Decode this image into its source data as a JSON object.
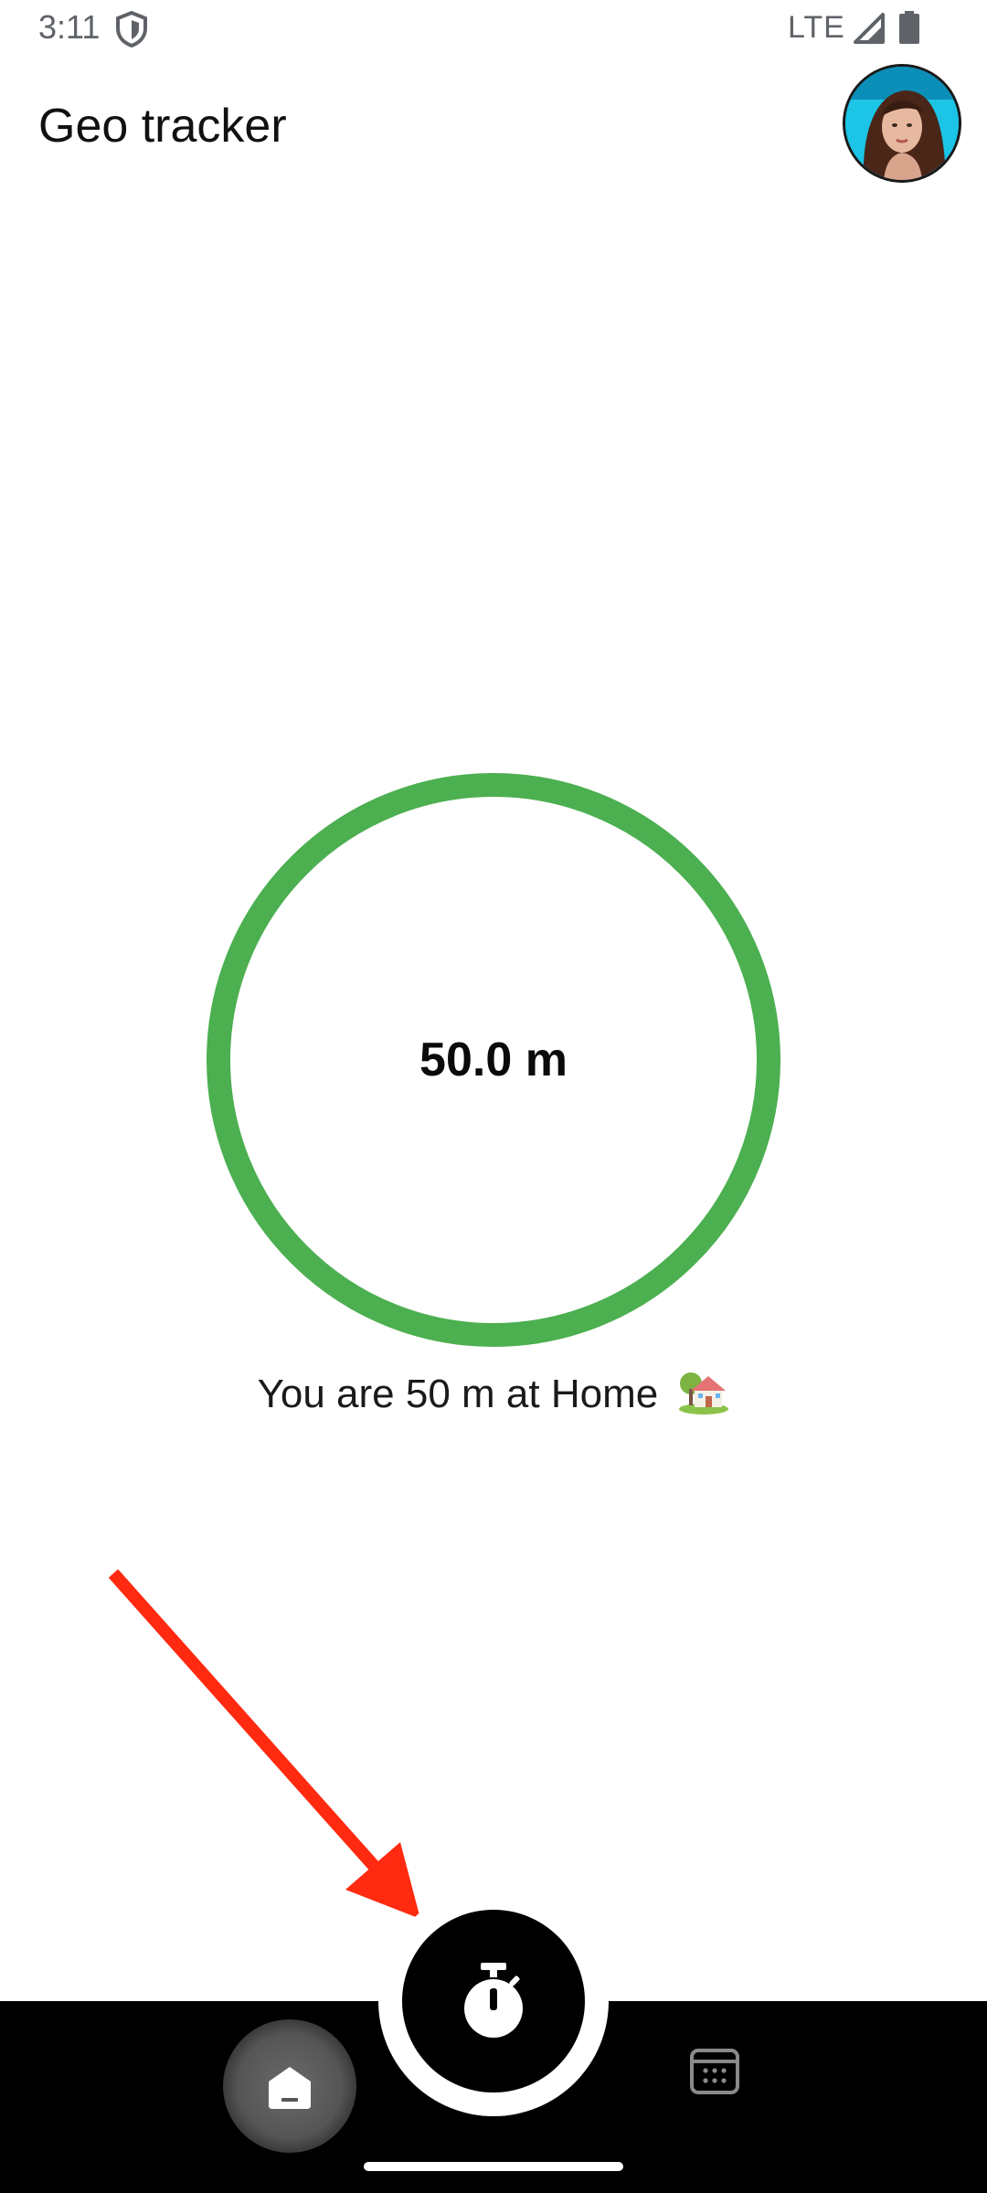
{
  "status_bar": {
    "time": "3:11",
    "network": "LTE",
    "icons": [
      "shield-icon",
      "signal-icon",
      "battery-icon"
    ]
  },
  "app_bar": {
    "title": "Geo tracker",
    "avatar_icon": "user-avatar"
  },
  "tracker": {
    "distance_label": "50.0 m",
    "message": "You are 50 m at Home",
    "message_emoji_icon": "house-with-garden-emoji",
    "ring_color": "#4caf50"
  },
  "bottom_nav": {
    "items": [
      {
        "icon": "home-icon",
        "selected": true
      },
      {
        "icon": "stopwatch-icon",
        "primary": true
      },
      {
        "icon": "calendar-icon",
        "selected": false
      }
    ]
  },
  "annotation": {
    "icon": "red-arrow-pointing-to-stopwatch",
    "color": "#ff2a10"
  },
  "colors": {
    "background": "#ffffff",
    "nav_background": "#000000",
    "accent": "#4caf50"
  }
}
